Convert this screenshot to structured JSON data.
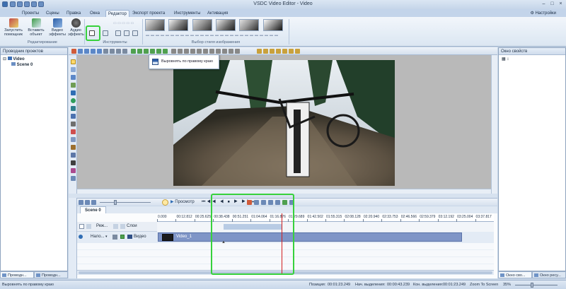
{
  "app": {
    "title": "VSDC Video Editor - Video"
  },
  "ribbon": {
    "tabs": [
      "Проекты",
      "Сцены",
      "Правка",
      "Окна",
      "Редактор",
      "Экспорт проекта",
      "Инструменты",
      "Активация"
    ],
    "active_tab": "Редактор",
    "settings_label": "Настройки",
    "buttons": [
      {
        "label": "Запустить помощник"
      },
      {
        "label": "Вставить объект"
      },
      {
        "label": "Видео эффекты"
      },
      {
        "label": "Аудио эффекты"
      }
    ],
    "groups": {
      "editing": "Редактирование",
      "tools": "Инструменты",
      "styles": "Выбор стиля изображения"
    }
  },
  "left_panel": {
    "title": "Проводник проектов",
    "tree": [
      {
        "label": "Video",
        "children": [
          "Scene 0"
        ]
      }
    ],
    "bottom_tabs": [
      "Проводн...",
      "Проводн..."
    ]
  },
  "right_panel": {
    "title": "Окно свойств",
    "bottom_tabs": [
      "Окно сво...",
      "Окно ресу..."
    ]
  },
  "tooltip": {
    "text": "Выровнять по правому краю"
  },
  "timeline": {
    "preview_label": "Просмотр",
    "scene_tab": "Scene 0",
    "ruler_labels": [
      "0.000",
      "00:12.812",
      "00:25.625",
      "00:38.438",
      "00:51.251",
      "01:04.064",
      "01:16.876",
      "01:29.689",
      "01:42.502",
      "01:55.315",
      "02:08.128",
      "02:20.940",
      "02:33.753",
      "02:46.566",
      "02:59.379",
      "03:12.192",
      "03:25.004",
      "03:37.817"
    ],
    "layer_header": {
      "mode": "Реж...",
      "layers": "Слои"
    },
    "track": {
      "blend": "Нало...",
      "name": "Видео",
      "clip_label": "Video_1"
    }
  },
  "status_bar": {
    "left_text": "Выровнять по правому краю",
    "position_label": "Позиция:",
    "position_value": "00:01:23.249",
    "sel_start_label": "Нач. выделения:",
    "sel_start_value": "00:00:43.239",
    "sel_end_label": "Кон. выделения:",
    "sel_end_value": "00:01:23.249",
    "zoom_label": "Zoom To Screen",
    "zoom_value": "35%"
  },
  "colors": {
    "highlight": "#37d13c",
    "playhead": "#d21f1f",
    "clip": "#7f95c7",
    "ribbon_bg": "#e6eef8"
  }
}
